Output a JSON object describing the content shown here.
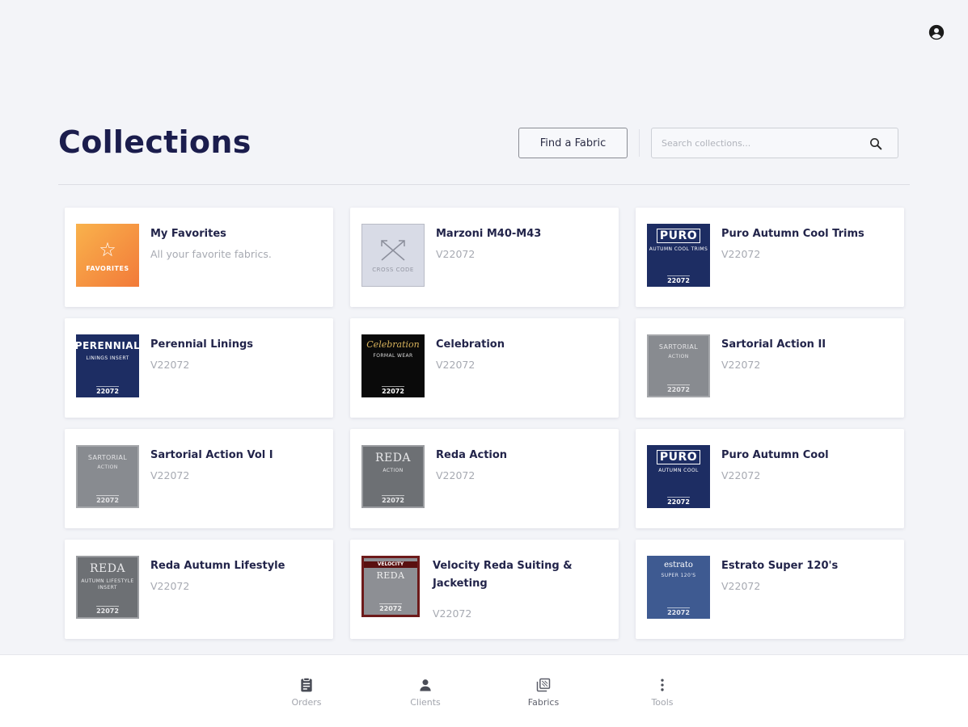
{
  "header": {
    "title": "Collections",
    "find_button": "Find a Fabric",
    "search_placeholder": "Search collections..."
  },
  "icons": {
    "account": "account-circle-icon",
    "search": "search-icon"
  },
  "cards": [
    {
      "title": "My Favorites",
      "subtitle": "All your favorite fabrics.",
      "thumb": {
        "kind": "favorites",
        "text": "FAVORITES"
      }
    },
    {
      "title": "Marzoni M40-M43",
      "subtitle": "V22072",
      "thumb": {
        "kind": "crosscode",
        "text": "CROSS CODE"
      }
    },
    {
      "title": "Puro Autumn Cool Trims",
      "subtitle": "V22072",
      "thumb": {
        "kind": "navy",
        "brand": "PURO",
        "line": "AUTUMN COOL TRIMS",
        "code": "22072"
      }
    },
    {
      "title": "Perennial Linings",
      "subtitle": "V22072",
      "thumb": {
        "kind": "navy",
        "brand": "PERENNIAL",
        "line": "LININGS INSERT",
        "code": "22072"
      }
    },
    {
      "title": "Celebration",
      "subtitle": "V22072",
      "thumb": {
        "kind": "black",
        "brand": "Celebration",
        "line": "FORMAL WEAR",
        "code": "22072"
      }
    },
    {
      "title": "Sartorial Action II",
      "subtitle": "V22072",
      "thumb": {
        "kind": "grey",
        "brand": "SARTORIAL",
        "line": "ACTION",
        "code": "22072"
      }
    },
    {
      "title": "Sartorial Action Vol I",
      "subtitle": "V22072",
      "thumb": {
        "kind": "grey",
        "brand": "SARTORIAL",
        "line": "ACTION",
        "code": "22072"
      }
    },
    {
      "title": "Reda Action",
      "subtitle": "V22072",
      "thumb": {
        "kind": "greyd",
        "brand": "REDA",
        "line": "ACTION",
        "code": "22072"
      }
    },
    {
      "title": "Puro Autumn Cool",
      "subtitle": "V22072",
      "thumb": {
        "kind": "navy",
        "brand": "PURO",
        "line": "AUTUMN COOL",
        "code": "22072"
      }
    },
    {
      "title": "Reda Autumn Lifestyle",
      "subtitle": "V22072",
      "thumb": {
        "kind": "greyd",
        "brand": "REDA",
        "line": "AUTUMN LIFESTYLE INSERT",
        "code": "22072"
      }
    },
    {
      "title": "Velocity Reda Suiting & Jacketing",
      "subtitle": "V22072",
      "thumb": {
        "kind": "velocity",
        "brand": "VELOCITY",
        "line": "REDA",
        "code": "22072"
      }
    },
    {
      "title": "Estrato Super 120's",
      "subtitle": "V22072",
      "thumb": {
        "kind": "estrato",
        "brand": "estrato",
        "line": "SUPER 120'S",
        "code": "22072"
      }
    }
  ],
  "bottom_nav": {
    "items": [
      {
        "label": "Orders",
        "icon": "orders-icon"
      },
      {
        "label": "Clients",
        "icon": "clients-icon"
      },
      {
        "label": "Fabrics",
        "icon": "fabrics-icon"
      },
      {
        "label": "Tools",
        "icon": "more-vert-icon"
      }
    ],
    "active": "Fabrics"
  }
}
